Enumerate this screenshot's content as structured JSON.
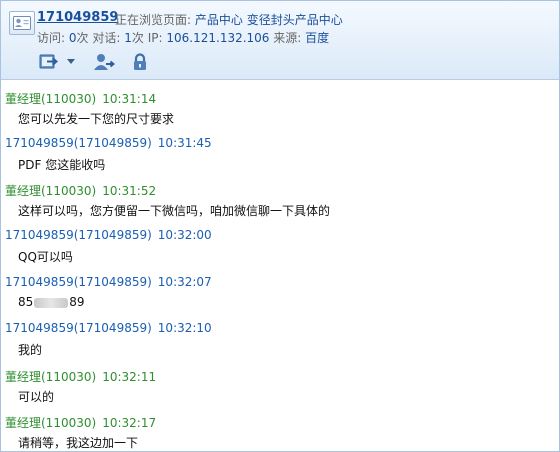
{
  "header": {
    "visitor_id": "171049859",
    "browsing_label": "正在浏览页面:",
    "current_page": "产品中心 变径封头产品中心",
    "stats": {
      "visits_label": "访问:",
      "visits_value": "0",
      "visits_unit": "次",
      "sessions_label": "对话:",
      "sessions_value": "1",
      "sessions_unit": "次",
      "ip_label": "IP:",
      "ip_value": "106.121.132.106",
      "source_label": "来源:",
      "source_value": "百度"
    },
    "toolbar": [
      "transfer-icon",
      "invite-user-icon",
      "lock-icon"
    ]
  },
  "messages": [
    {
      "sender": "董经理(110030)",
      "time": "10:31:14",
      "role": "agent",
      "text": "您可以先发一下您的尺寸要求"
    },
    {
      "sender": "171049859(171049859)",
      "time": "10:31:45",
      "role": "visitor",
      "text": "PDF 您这能收吗"
    },
    {
      "sender": "董经理(110030)",
      "time": "10:31:52",
      "role": "agent",
      "text": "这样可以吗，您方便留一下微信吗，咱加微信聊一下具体的"
    },
    {
      "sender": "171049859(171049859)",
      "time": "10:32:00",
      "role": "visitor",
      "text": "QQ可以吗"
    },
    {
      "sender": "171049859(171049859)",
      "time": "10:32:07",
      "role": "visitor",
      "text_before": "85",
      "text_after": "89"
    },
    {
      "sender": "171049859(171049859)",
      "time": "10:32:10",
      "role": "visitor",
      "text": "我的"
    },
    {
      "sender": "董经理(110030)",
      "time": "10:32:11",
      "role": "agent",
      "text": "可以的"
    },
    {
      "sender": "董经理(110030)",
      "time": "10:32:17",
      "role": "agent",
      "text": "请稍等，我这边加一下"
    }
  ],
  "colors": {
    "agent": "#2f8f2f",
    "visitor": "#1a5fb4",
    "link": "#1a4f9c"
  }
}
